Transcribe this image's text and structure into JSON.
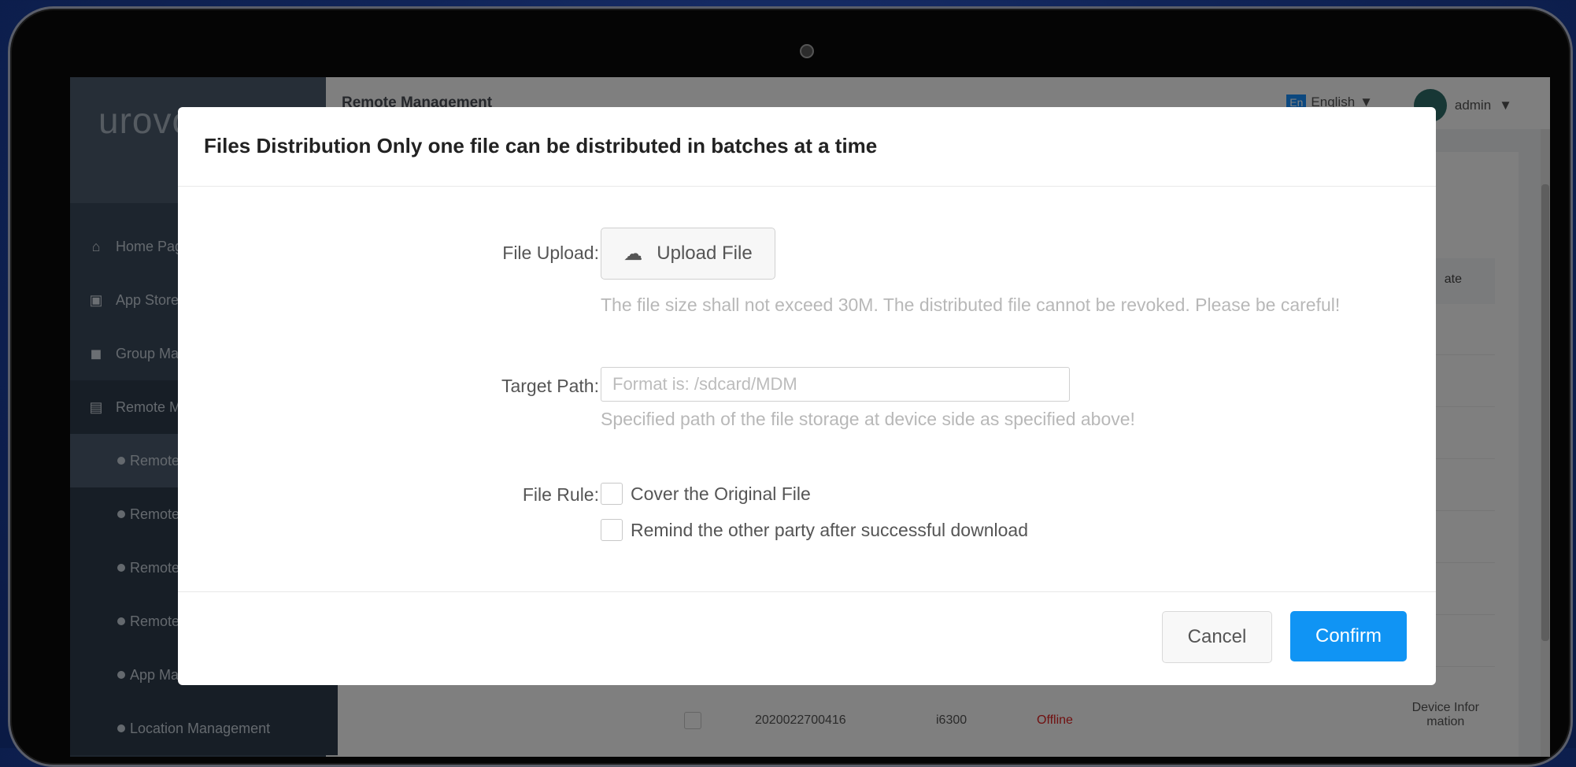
{
  "app": {
    "brand": "urovo",
    "page_title": "Remote Management",
    "language": {
      "badge": "En",
      "label": "English"
    },
    "user": {
      "name": "admin"
    }
  },
  "sidebar": {
    "items": [
      {
        "label": "Home Page"
      },
      {
        "label": "App Store"
      },
      {
        "label": "Group Management"
      },
      {
        "label": "Remote Management"
      },
      {
        "label": "Remote"
      },
      {
        "label": "Remote"
      },
      {
        "label": "Remote"
      },
      {
        "label": "Remote"
      },
      {
        "label": "App Management"
      },
      {
        "label": "Location Management"
      }
    ]
  },
  "table": {
    "header_partial": "ate",
    "row_cell_partial": [
      "Infor",
      "ion"
    ],
    "last_row": {
      "sn": "2020022700416",
      "model": "i6300",
      "status": "Offline",
      "action_line1": "Device Infor",
      "action_line2": "mation"
    }
  },
  "modal": {
    "title": "Files Distribution Only one file can be distributed in batches at a time",
    "file_upload_label": "File Upload:",
    "upload_button_label": "Upload File",
    "upload_help": "The file size shall not exceed 30M. The distributed file cannot be revoked. Please be careful!",
    "target_path_label": "Target Path:",
    "target_path_value": "",
    "target_path_placeholder": "Format is: /sdcard/MDM",
    "target_path_help": "Specified path of the file storage at device side as specified above!",
    "file_rule_label": "File Rule:",
    "rules": [
      {
        "label": "Cover the Original File",
        "checked": false
      },
      {
        "label": "Remind the other party after successful download",
        "checked": false
      }
    ],
    "cancel_label": "Cancel",
    "confirm_label": "Confirm"
  },
  "colors": {
    "primary": "#1094f4",
    "sidebar_bg": "#3a4a5c",
    "status_offline": "#e02020"
  }
}
